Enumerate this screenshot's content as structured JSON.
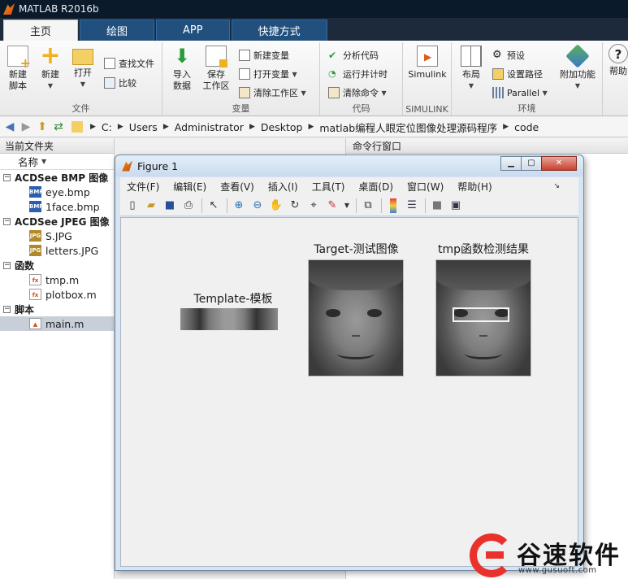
{
  "app": {
    "title": "MATLAB R2016b"
  },
  "ribbon_tabs": [
    "主页",
    "绘图",
    "APP",
    "快捷方式"
  ],
  "ribbon": {
    "file": {
      "label": "文件",
      "new_script": "新建\n脚本",
      "new": "新建",
      "open": "打开",
      "find_files": "查找文件",
      "compare": "比较"
    },
    "variable": {
      "label": "变量",
      "import": "导入\n数据",
      "save_ws": "保存\n工作区",
      "new_var": "新建变量",
      "open_var": "打开变量",
      "clear_ws": "清除工作区"
    },
    "code": {
      "label": "代码",
      "analyze": "分析代码",
      "run_time": "运行并计时",
      "clear_cmd": "清除命令"
    },
    "simulink": {
      "label": "SIMULINK",
      "simulink": "Simulink"
    },
    "env": {
      "label": "环境",
      "layout": "布局",
      "prefs": "预设",
      "set_path": "设置路径",
      "parallel": "Parallel",
      "addons": "附加功能",
      "help": "帮助"
    }
  },
  "address": {
    "parts": [
      "C:",
      "Users",
      "Administrator",
      "Desktop",
      "matlab编程人眼定位图像处理源码程序",
      "code"
    ]
  },
  "current_folder": {
    "title": "当前文件夹",
    "col_name": "名称",
    "groups": [
      {
        "name": "ACDSee BMP 图像",
        "items": [
          "eye.bmp",
          "1face.bmp"
        ]
      },
      {
        "name": "ACDSee JPEG 图像",
        "items": [
          "S.JPG",
          "letters.JPG"
        ]
      },
      {
        "name": "函数",
        "items": [
          "tmp.m",
          "plotbox.m"
        ]
      },
      {
        "name": "脚本",
        "items": [
          "main.m"
        ]
      }
    ]
  },
  "command_window": {
    "title": "命令行窗口"
  },
  "figure": {
    "title": "Figure 1",
    "menu": [
      "文件(F)",
      "编辑(E)",
      "查看(V)",
      "插入(I)",
      "工具(T)",
      "桌面(D)",
      "窗口(W)",
      "帮助(H)"
    ],
    "axes": {
      "template_title": "Template-模板",
      "target_title": "Target-测试图像",
      "result_title": "tmp函数检测结果"
    }
  },
  "watermark": {
    "name": "谷速软件",
    "url": "www.gusuoft.com"
  }
}
